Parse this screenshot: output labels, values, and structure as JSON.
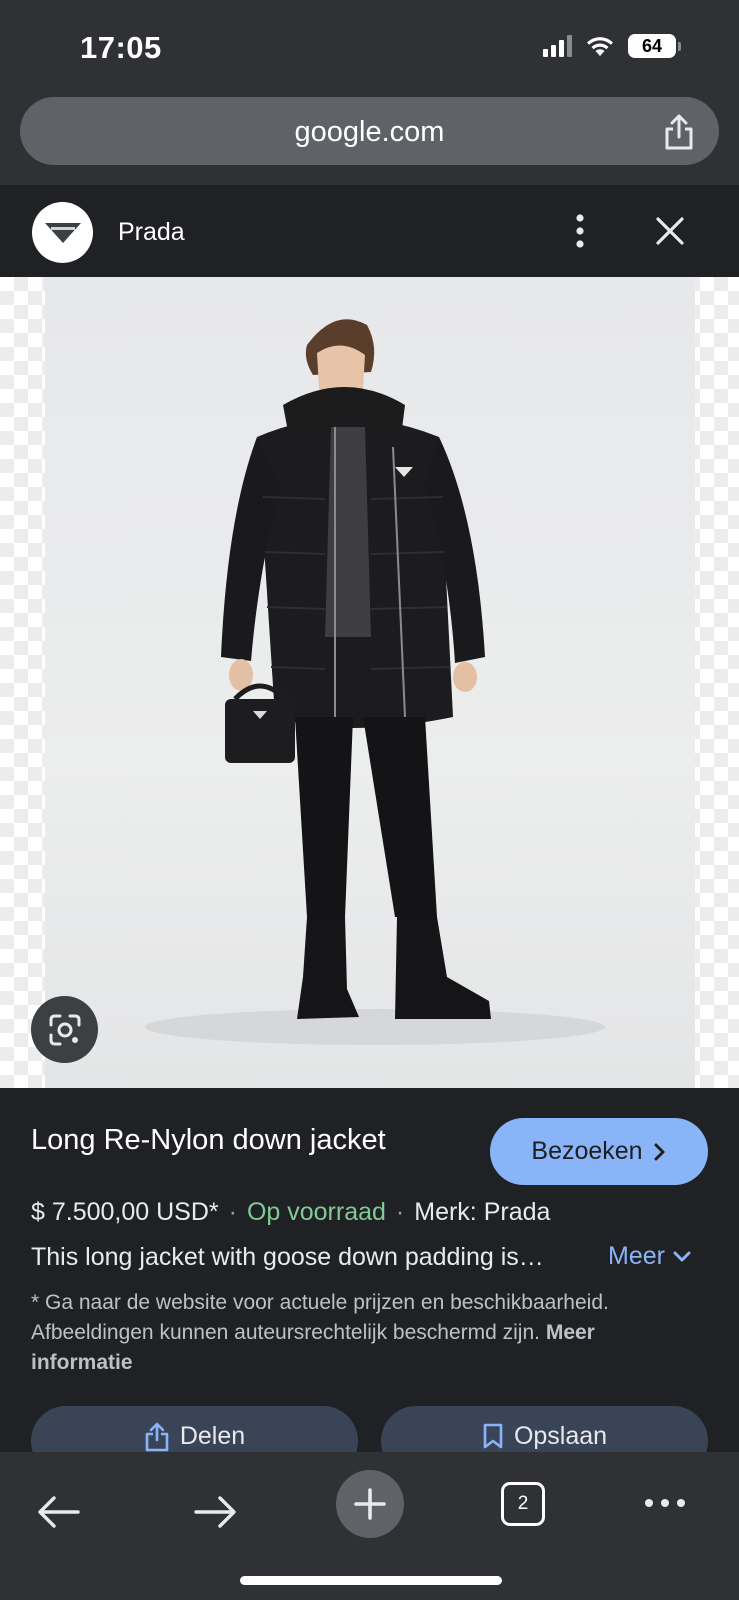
{
  "status_bar": {
    "time": "17:05",
    "battery": "64",
    "icons": [
      "cellular-signal-icon",
      "wifi-icon",
      "battery-icon"
    ]
  },
  "browser": {
    "url": "google.com",
    "share_icon": "share-icon"
  },
  "source": {
    "name": "Prada",
    "logo_icon": "prada-triangle-logo",
    "menu_icon": "more-vert-icon",
    "close_icon": "close-icon"
  },
  "image": {
    "lens_icon": "google-lens-icon"
  },
  "product": {
    "title": "Long Re-Nylon down jacket",
    "visit_label": "Bezoeken",
    "price": "$ 7.500,00 USD*",
    "stock": "Op voorraad",
    "brand": "Merk: Prada",
    "description": "This long jacket with goose down padding is…",
    "more_label": "Meer",
    "disclaimer": "* Ga naar de website voor actuele prijzen en beschikbaarheid. Afbeeldingen kunnen auteursrechtelijk beschermd zijn.",
    "more_info_label": "Meer informatie",
    "share_label": "Delen",
    "save_label": "Opslaan"
  },
  "toolbar": {
    "tab_count": "2",
    "icons": [
      "back-arrow-icon",
      "forward-arrow-icon",
      "plus-icon",
      "tabs-icon",
      "more-horiz-icon"
    ]
  },
  "colors": {
    "accent": "#8ab4f8",
    "stock_green": "#81c995",
    "panel_bg": "#202124",
    "chrome_bg": "#303134"
  }
}
